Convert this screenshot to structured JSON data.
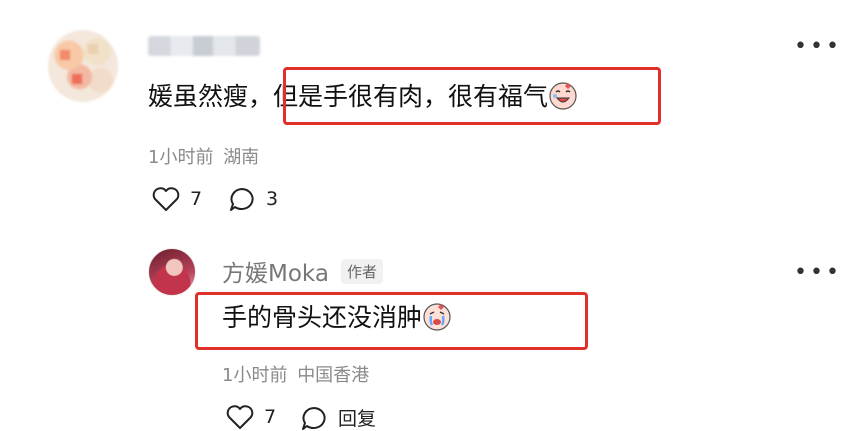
{
  "comment": {
    "text": "媛虽然瘦，但是手很有肉，很有福气",
    "time": "1小时前",
    "location": "湖南",
    "likes": "7",
    "replies": "3"
  },
  "reply": {
    "author": "方媛Moka",
    "badge": "作者",
    "text": "手的骨头还没消肿",
    "time": "1小时前",
    "location": "中国香港",
    "likes": "7",
    "reply_label": "回复"
  },
  "icons": {
    "more": "more-dots-icon",
    "like": "heart-outline-icon",
    "reply": "speech-bubble-icon",
    "emoji1": "laughing-with-tears-emoji",
    "emoji2": "crying-face-emoji"
  },
  "colors": {
    "highlight_box": "#e0302b",
    "meta_text": "#8a8a8a"
  }
}
